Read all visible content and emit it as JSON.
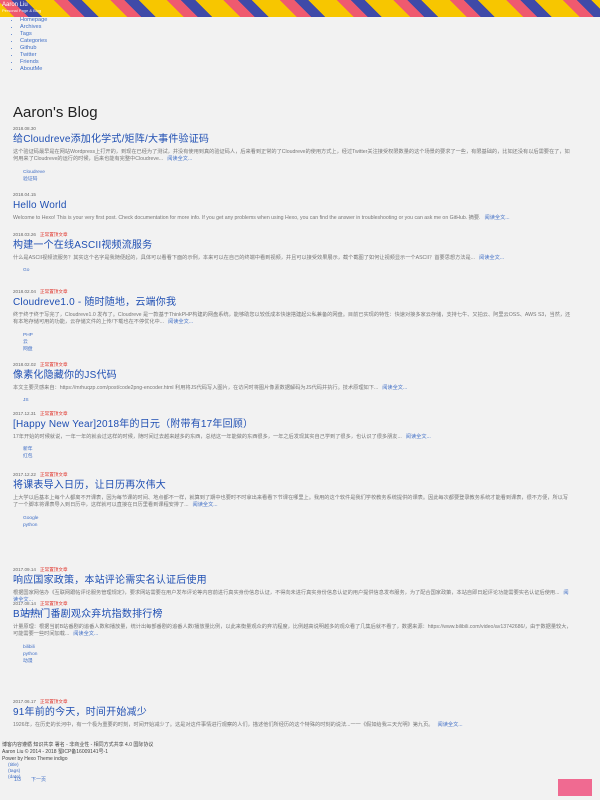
{
  "header": {
    "brand_title": "Aaron Liu",
    "brand_subtitle": "Personal Page & Blog",
    "menu": [
      "Homepage",
      "Archives",
      "Tags",
      "Categories",
      "Github",
      "Twitter",
      "Friends",
      "AboutMe"
    ]
  },
  "blog_title": "Aaron's Blog",
  "posts": [
    {
      "date": "2018.08.30",
      "top": "",
      "title": "给Cloudreve添加化学式/矩阵/大事件验证码",
      "excerpt": "这个验证码最早是在网站Wordpress上打开的，到现在已经为了测试，并没有使用到真的验证码人，后来看到正常的了Cloudreve的使用方式上，经过Twitter关注接受权限数量的这个场景的要求了一些，有限基础的，比如还没有以后需要在了，如何用来了Cloudreve的运行的时候，后来也能有完整中Cloudreve...",
      "more": "阅读全文...",
      "tags": [
        "Cloudreve",
        "验证码"
      ]
    },
    {
      "date": "2018.04.15",
      "top": "",
      "title": "Hello World",
      "excerpt": "Welcome to Hexo! This is your very first post. Check documentation for more info. If you get any problems when using Hexo, you can find the answer in troubleshooting or you can ask me on GitHub. 摘要.",
      "more": "阅读全文...",
      "tags": []
    },
    {
      "date": "2018.03.26",
      "top": "正常置顶文章",
      "title": "构建一个在线ASCII视频流服务",
      "excerpt": "什么是ASCII视频流服务？其实这个名字是我随便起的，具体可以看看下面的示例，本来可以在自己的终端中看到视频，并且可以接受效果展示，截个截图了如何让视频显示一个ASCII？首要思想方法是...",
      "more": "阅读全文...",
      "tags": [
        "Go"
      ]
    },
    {
      "date": "2018.02.04",
      "top": "正常置顶文章",
      "title": "Cloudreve1.0 - 随时随地，云端你我",
      "excerpt": "终于终于终于写完了，Cloudreve1.0 发布了。Cloudreve 是一款基于ThinkPHP构建的网盘系统，能够助您以较低成本快速搭建起公私兼备的网盘。目前已实现的特性：快速对接多家云存储，支持七牛、又拍云、阿里云OSS、AWS S3，当然，还有本地存储可用的功能，云存储文件的上传/下载也在不停优化中...",
      "more": "阅读全文...",
      "tags": [
        "PHP",
        "云",
        "网盘"
      ]
    },
    {
      "date": "2018.02.02",
      "top": "正常置顶文章",
      "title": "像素化隐藏你的JS代码",
      "excerpt": "本文主要灵感来自：https://mrhuqzp.com/post/code2png-encoder.html 利用将JS代码写入图片，在访问时将图片像素数据解码为JS代码并执行。技术原理如下...",
      "more": "阅读全文...",
      "tags": [
        "JS"
      ]
    },
    {
      "date": "2017.12.31",
      "top": "正常置顶文章",
      "title": "[Happy New Year]2018年的日元（附带有17年回顾）",
      "excerpt": "17年开始的时候就说，一年一年的就会过这样的时候，随时间过去越来越多的东西，总结这一年能做的东西很多，一年之后发现其实自己学到了很多，也认识了很多朋友...",
      "more": "阅读全文...",
      "tags": [
        "新年",
        "红包"
      ]
    },
    {
      "date": "2017.12.22",
      "top": "正常置顶文章",
      "title": "将课表导入日历，让日历再次伟大",
      "excerpt": "上大学以后基本上每个人都离不开课表，因为每节课的时间、地点都不一样，就算到了期中也要时不时拿出来看看下节课在哪里上。我用的这个软件是我们学校教务系统提供的课表。因此每次都要登录教务系统才能看到课表，很不方便，所以写了一个脚本将课表导入到日历中，这样就可以直接在日历里看到课程安排了...",
      "more": "阅读全文...",
      "tags": [
        "Google",
        "python"
      ]
    },
    {
      "date": "2017.09.14",
      "top": "正常置顶文章",
      "title": "响应国家政策，本站评论需实名认证后使用",
      "excerpt": "根据国家网信办《互联网跟帖评论服务管理规定》，要求网站需要在用户发布评论等内容前进行真实身份信息认证，不得向未进行真实身份信息认证的用户提供信息发布服务，为了配合国家政策，本站自即日起评论功能需要实名认证后使用...",
      "more": "阅读全文...",
      "tags": [
        "实名认证"
      ]
    },
    {
      "date": "2017.08.14",
      "top": "正常置顶文章",
      "title": "B站热门番剧观众弃坑指数排行榜",
      "excerpt": "计量原理：根据当前B站番剧的追番人数和播放量，统计出每部番剧的追番人数/播放量比例，以此来衡量观众的弃坑程度，比例越高说明越多的观众看了几集后就不看了，数据来源：https://www.bilibili.com/video/av13742686/，由于数据量较大，可能需要一些时间加载...",
      "more": "阅读全文...",
      "tags": [
        "bilibili",
        "python",
        "动漫"
      ]
    },
    {
      "date": "2017.06.17",
      "top": "正常置顶文章",
      "title": "91年前的今天，时间开始减少",
      "excerpt": "1926年，在历史的长河中，有一个极为重要的时刻，时间开始减少了。这是对这件事情进行观察的人们，描述他们所经历的这个特殊的时刻的说法...一一《假如给我三天光明》第九页。",
      "more": "阅读全文...",
      "tags": []
    }
  ],
  "pager": [
    "1/3",
    "下一页"
  ],
  "footer": {
    "license": "博客内容遵循 知识共享 署名 - 非商业性 - 相同方式共享 4.0 国际协议",
    "copyright": "Aaron Liu © 2014 - 2018 蜀ICP备16009141号-1",
    "powered": "Power by Hexo Theme indigo",
    "links": [
      "(title)",
      "(tags)",
      "(date)"
    ]
  },
  "colors": {
    "accent": "#3f6ec6",
    "title_blue": "#1f4fb3",
    "top_red": "#e0342b",
    "pink": "#f06a91"
  }
}
